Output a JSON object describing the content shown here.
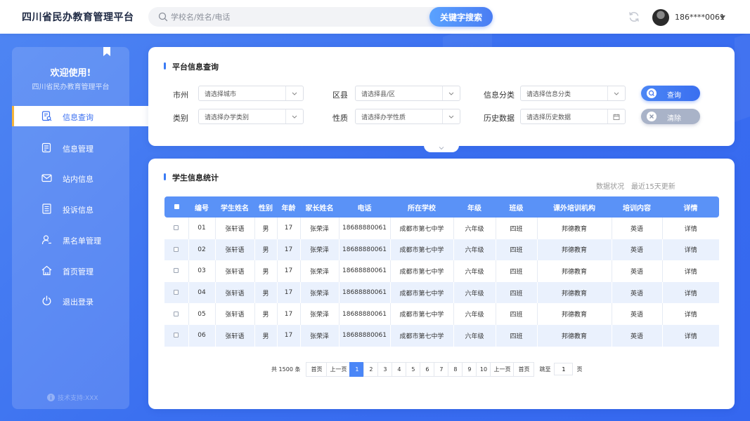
{
  "app": {
    "title": "四川省民办教育管理平台"
  },
  "search": {
    "placeholder": "学校名/姓名/电话",
    "button": "关键字搜索"
  },
  "user": {
    "phone": "186****0061"
  },
  "sidebar": {
    "welcome": "欢迎使用!",
    "subtitle": "四川省民办教育管理平台",
    "items": [
      {
        "label": "信息查询",
        "icon": "search-doc-icon",
        "active": true
      },
      {
        "label": "信息管理",
        "icon": "doc-edit-icon",
        "active": false
      },
      {
        "label": "站内信息",
        "icon": "mail-icon",
        "active": false
      },
      {
        "label": "投诉信息",
        "icon": "list-doc-icon",
        "active": false
      },
      {
        "label": "黑名单管理",
        "icon": "user-blacklist-icon",
        "active": false
      },
      {
        "label": "首页管理",
        "icon": "home-icon",
        "active": false
      },
      {
        "label": "退出登录",
        "icon": "power-icon",
        "active": false
      }
    ],
    "footer": "技术支持:XXX"
  },
  "query": {
    "title": "平台信息查询",
    "fields": {
      "city": {
        "label": "市州",
        "placeholder": "请选择城市"
      },
      "district": {
        "label": "区县",
        "placeholder": "请选择县/区"
      },
      "info_type": {
        "label": "信息分类",
        "placeholder": "请选择信息分类"
      },
      "category": {
        "label": "类别",
        "placeholder": "请选择办学类别"
      },
      "nature": {
        "label": "性质",
        "placeholder": "请选择办学性质"
      },
      "history": {
        "label": "历史数据",
        "placeholder": "请选择历史数据"
      }
    },
    "query_button": "查询",
    "clear_button": "清除"
  },
  "students": {
    "title": "学生信息统计",
    "status": "数据状况",
    "updated": "最近15天更新",
    "columns": [
      "编号",
      "学生姓名",
      "性别",
      "年龄",
      "家长姓名",
      "电话",
      "所在学校",
      "年级",
      "班级",
      "课外培训机构",
      "培训内容",
      "详情"
    ],
    "rows": [
      [
        "01",
        "张轩语",
        "男",
        "17",
        "张荣泽",
        "18688880061",
        "成都市第七中学",
        "六年级",
        "四班",
        "邦德教育",
        "英语",
        "详情"
      ],
      [
        "02",
        "张轩语",
        "男",
        "17",
        "张荣泽",
        "18688880061",
        "成都市第七中学",
        "六年级",
        "四班",
        "邦德教育",
        "英语",
        "详情"
      ],
      [
        "03",
        "张轩语",
        "男",
        "17",
        "张荣泽",
        "18688880061",
        "成都市第七中学",
        "六年级",
        "四班",
        "邦德教育",
        "英语",
        "详情"
      ],
      [
        "04",
        "张轩语",
        "男",
        "17",
        "张荣泽",
        "18688880061",
        "成都市第七中学",
        "六年级",
        "四班",
        "邦德教育",
        "英语",
        "详情"
      ],
      [
        "05",
        "张轩语",
        "男",
        "17",
        "张荣泽",
        "18688880061",
        "成都市第七中学",
        "六年级",
        "四班",
        "邦德教育",
        "英语",
        "详情"
      ],
      [
        "06",
        "张轩语",
        "男",
        "17",
        "张荣泽",
        "18688880061",
        "成都市第七中学",
        "六年级",
        "四班",
        "邦德教育",
        "英语",
        "详情"
      ]
    ]
  },
  "pagination": {
    "total_prefix": "共",
    "total": "1500",
    "total_suffix": "条",
    "first": "首页",
    "prev": "上一页",
    "pages": [
      "1",
      "2",
      "3",
      "4",
      "5",
      "6",
      "7",
      "8",
      "9",
      "10"
    ],
    "current": "1",
    "next": "上一页",
    "last": "首页",
    "jump_label": "跳至",
    "jump_value": "1",
    "jump_suffix": "页"
  },
  "colors": {
    "background": "#3a6ff0",
    "accent": "#4a86f7",
    "table_header": "#5a92f7",
    "active_marker": "#f4b43a"
  }
}
